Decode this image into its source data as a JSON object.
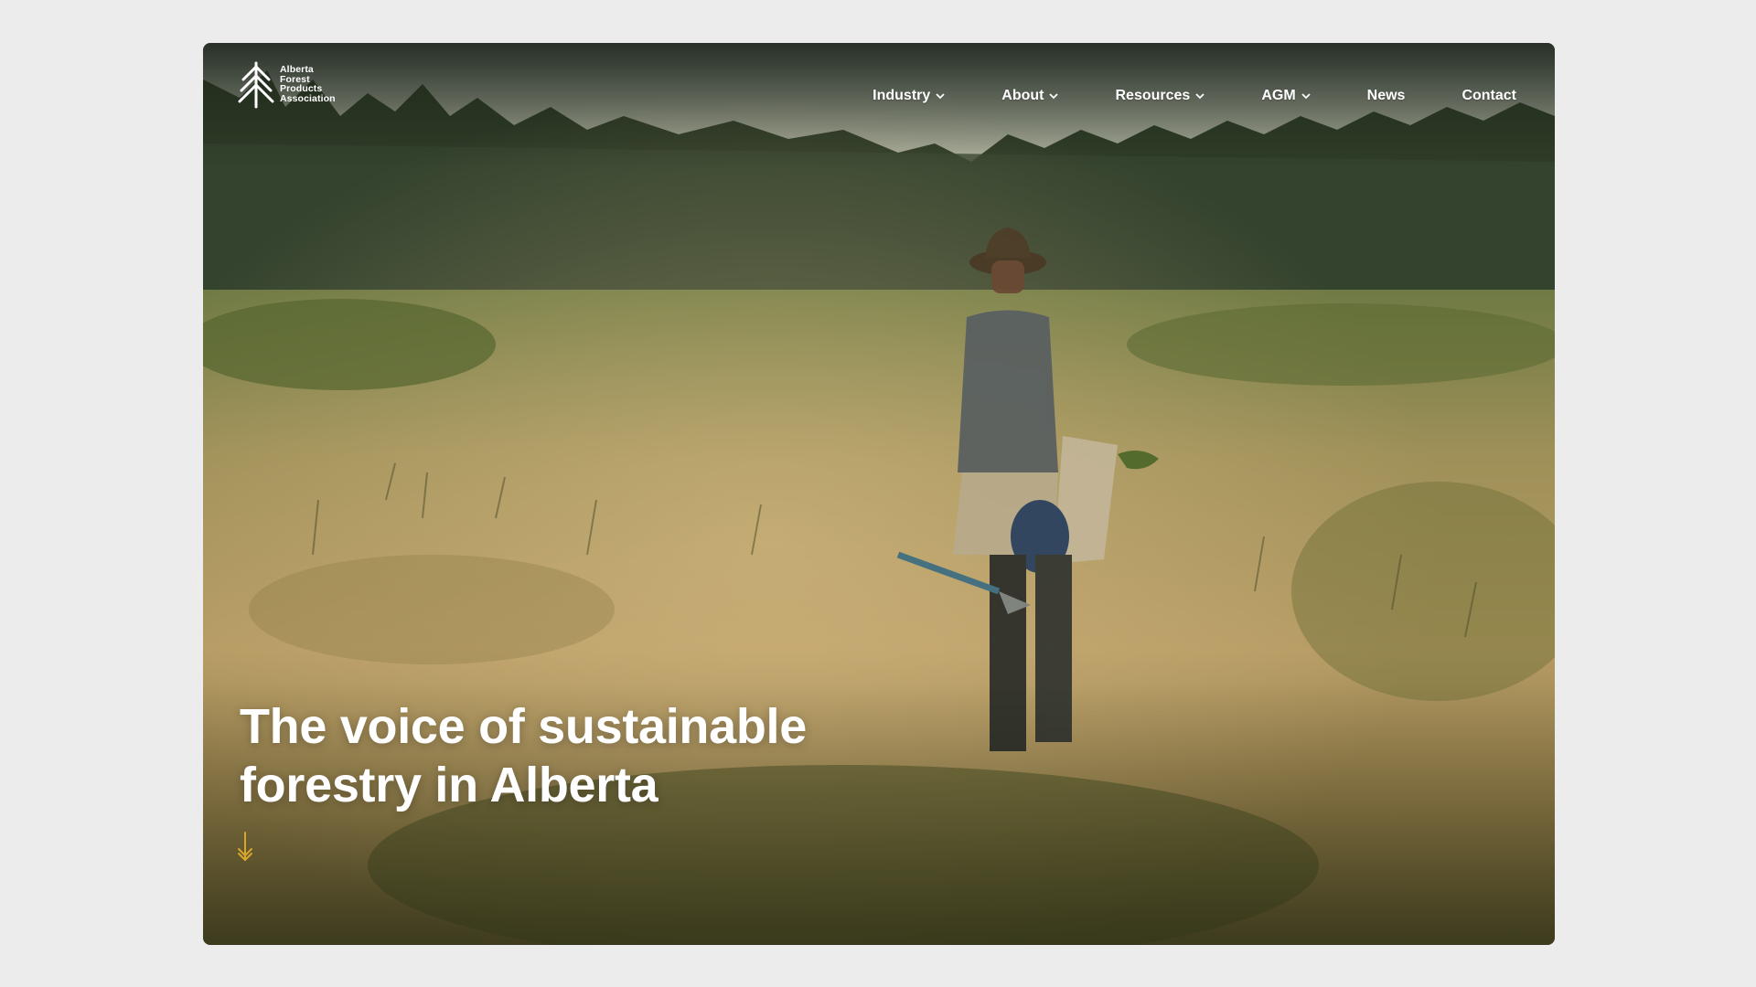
{
  "brand": {
    "name_lines": [
      "Alberta",
      "Forest",
      "Products",
      "Association"
    ],
    "logo_icon": "tree-icon"
  },
  "nav": {
    "items": [
      {
        "label": "Industry",
        "has_dropdown": true
      },
      {
        "label": "About",
        "has_dropdown": true
      },
      {
        "label": "Resources",
        "has_dropdown": true
      },
      {
        "label": "AGM",
        "has_dropdown": true
      },
      {
        "label": "News",
        "has_dropdown": false
      },
      {
        "label": "Contact",
        "has_dropdown": false
      }
    ]
  },
  "hero": {
    "title_lines": [
      "The voice of sustainable",
      "forestry in Alberta"
    ],
    "scroll_icon": "arrow-down-icon",
    "accent_color": "#d9a62b"
  }
}
